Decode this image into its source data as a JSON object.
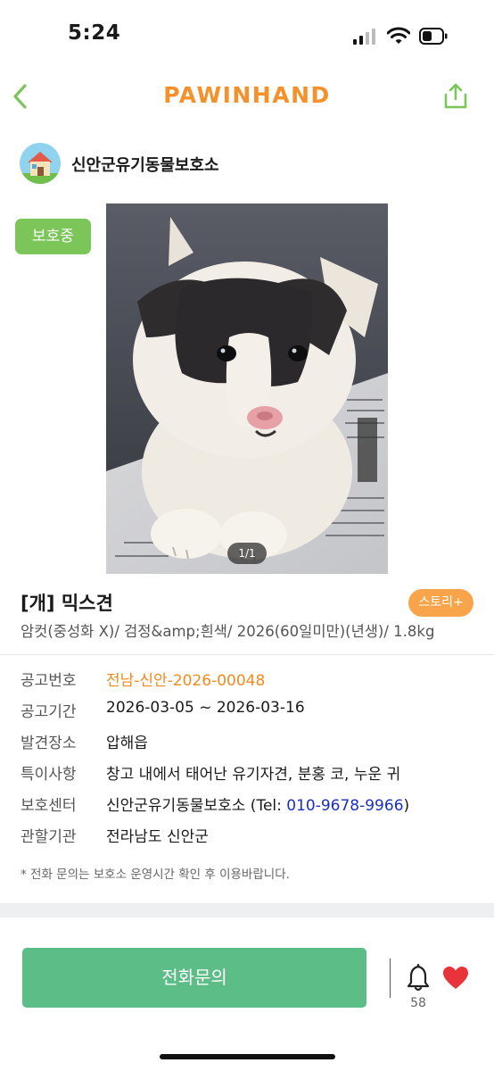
{
  "status_bar": {
    "time": "5:24"
  },
  "header": {
    "brand": "PAWINHAND"
  },
  "shelter": {
    "name": "신안군유기동물보호소"
  },
  "badge": {
    "status": "보호중"
  },
  "photo": {
    "counter": "1/1"
  },
  "pet": {
    "title": "[개] 믹스견",
    "summary": "암컷(중성화 X)/ 검정&amp;흰색/ 2026(60일미만)(년생)/ 1.8kg",
    "story_button": "스토리+"
  },
  "info": {
    "notice_no": {
      "label": "공고번호",
      "value": "전남-신안-2026-00048"
    },
    "period": {
      "label": "공고기간",
      "value": "2026-03-05 ~ 2026-03-16"
    },
    "found_place": {
      "label": "발견장소",
      "value": "압해읍"
    },
    "features": {
      "label": "특이사항",
      "value": "창고 내에서 태어난 유기자견, 분홍 코, 누운 귀"
    },
    "center": {
      "label": "보호센터",
      "name": "신안군유기동물보호소",
      "tel_prefix": " (Tel: ",
      "tel": "010-9678-9966",
      "tel_suffix": ")"
    },
    "authority": {
      "label": "관할기관",
      "value": "전라남도 신안군"
    }
  },
  "notice_text": "* 전화 문의는 보호소 운영시간 확인 후 이용바랍니다.",
  "bottom_bar": {
    "call_label": "전화문의",
    "bell_count": "58"
  },
  "colors": {
    "brand": "#f5902a",
    "badge": "#7cc558",
    "call_button": "#5dbd86",
    "story": "#f8a44b",
    "heart": "#e8333b",
    "link": "#1a2fc0"
  },
  "icons": [
    "back-chevron-icon",
    "share-icon",
    "house-icon",
    "bell-icon",
    "heart-icon",
    "signal-icon",
    "wifi-icon",
    "battery-icon"
  ]
}
